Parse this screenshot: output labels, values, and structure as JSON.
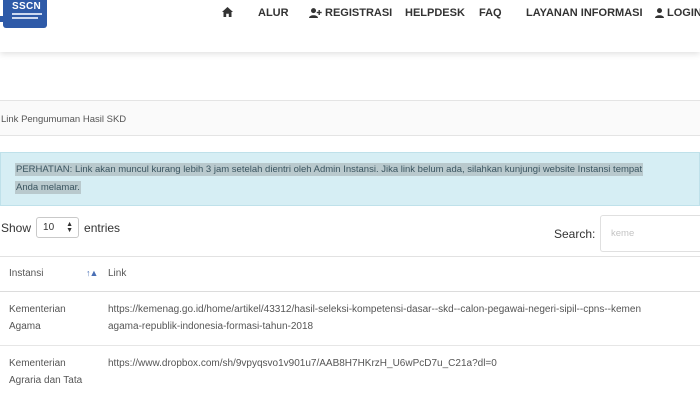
{
  "logo": {
    "text": "SSCN"
  },
  "nav": {
    "items": [
      {
        "label": "",
        "icon": "home-icon"
      },
      {
        "label": "ALUR"
      },
      {
        "label": "REGISTRASI",
        "icon": "user-plus-icon"
      },
      {
        "label": "HELPDESK"
      },
      {
        "label": "FAQ"
      },
      {
        "label": "LAYANAN INFORMASI"
      },
      {
        "label": "LOGIN",
        "icon": "user-icon"
      }
    ]
  },
  "page_header": {
    "title": "Link Pengumuman Hasil SKD"
  },
  "alert": {
    "line1": "PERHATIAN: Link akan muncul kurang lebih 3 jam setelah dientri oleh Admin Instansi. Jika link belum ada, silahkan kunjungi website Instansi tempat",
    "line2": "Anda melamar."
  },
  "controls": {
    "show_label": "Show",
    "entries_value": "10",
    "entries_label": "entries",
    "search_label": "Search:",
    "search_value": "keme"
  },
  "table": {
    "headers": {
      "instansi": "Instansi",
      "link": "Link"
    },
    "rows": [
      {
        "instansi_line1": "Kementerian",
        "instansi_line2": "Agama",
        "link_line1": "https://kemenag.go.id/home/artikel/43312/hasil-seleksi-kompetensi-dasar--skd--calon-pegawai-negeri-sipil--cpns--kemen",
        "link_line2": "agama-republik-indonesia-formasi-tahun-2018"
      },
      {
        "instansi_line1": "Kementerian",
        "instansi_line2": "Agraria dan Tata",
        "link_line1": "https://www.dropbox.com/sh/9vpyqsvo1v901u7/AAB8H7HKrzH_U6wPcD7u_C21a?dl=0",
        "link_line2": ""
      }
    ]
  },
  "colors": {
    "brand": "#2e5aa8",
    "alert_bg": "#d6eef4",
    "sort_icon": "#4a6fb5"
  }
}
